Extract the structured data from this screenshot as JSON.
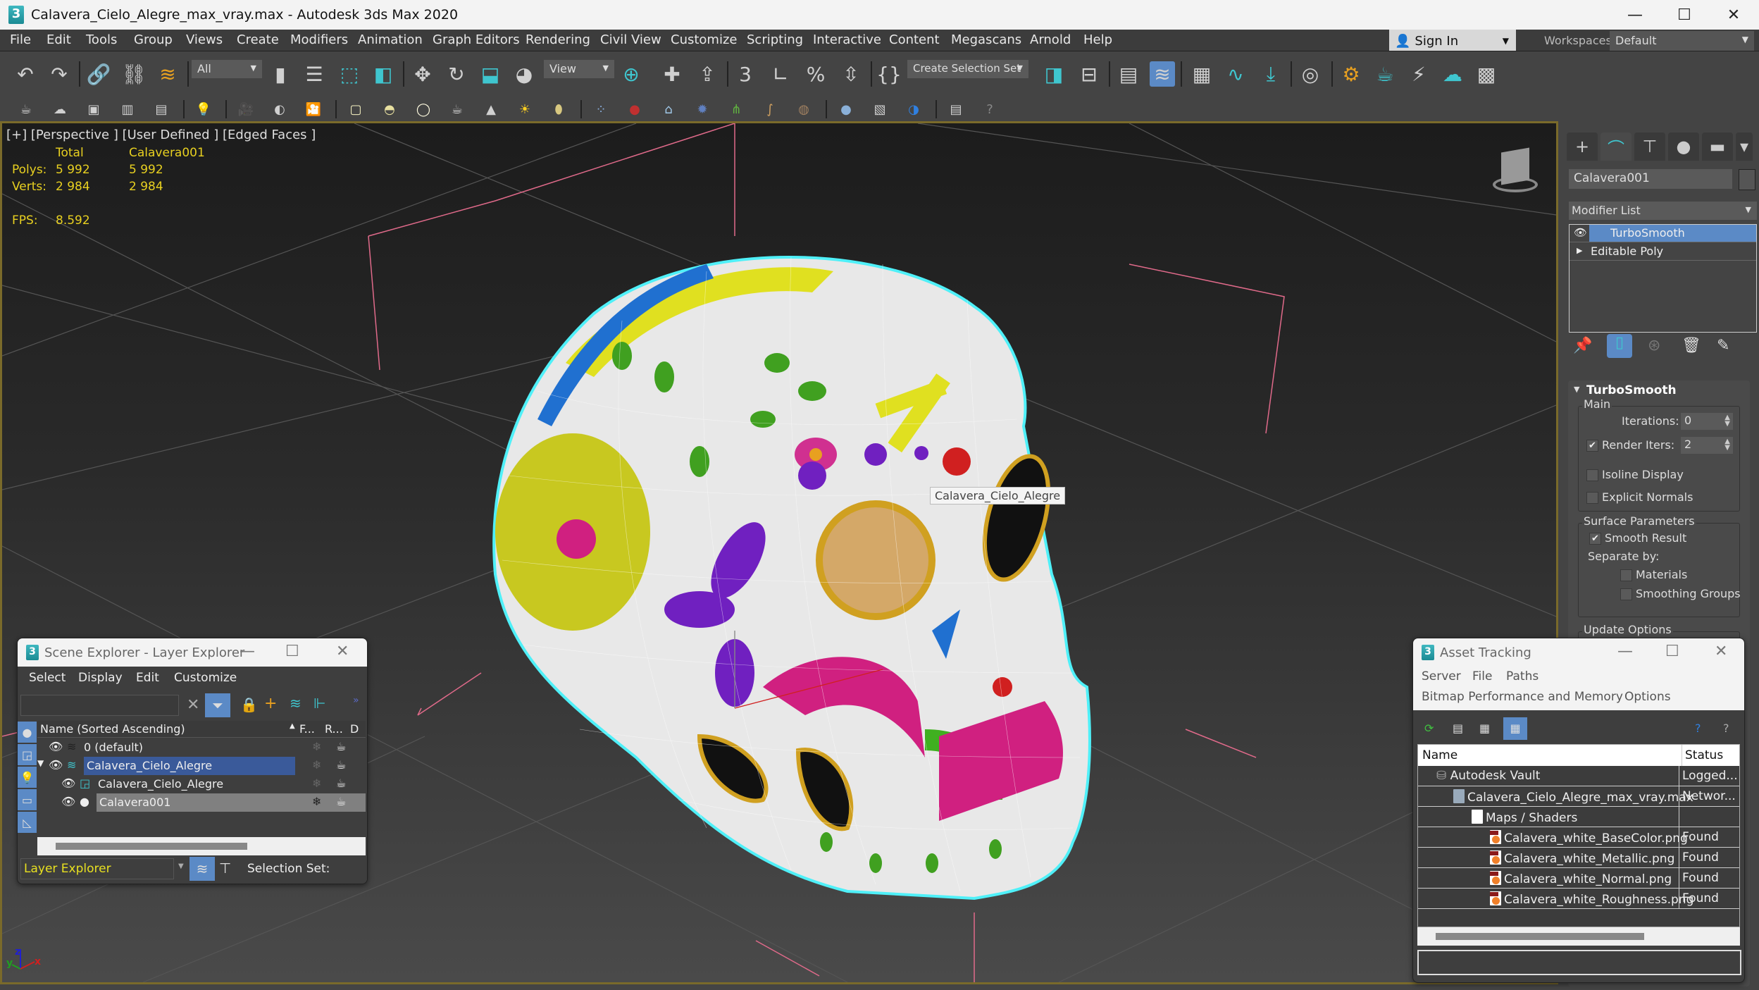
{
  "window": {
    "title": "Calavera_Cielo_Alegre_max_vray.max - Autodesk 3ds Max 2020",
    "app_icon_label": "3",
    "minimize": "—",
    "maximize": "☐",
    "close": "✕"
  },
  "menu": {
    "items": [
      "File",
      "Edit",
      "Tools",
      "Group",
      "Views",
      "Create",
      "Modifiers",
      "Animation",
      "Graph Editors",
      "Rendering",
      "Civil View",
      "Customize",
      "Scripting",
      "Interactive",
      "Content",
      "Megascans",
      "Arnold",
      "Help"
    ]
  },
  "account": {
    "sign_in_label": "Sign In",
    "workspaces_label": "Workspaces:",
    "workspace_value": "Default"
  },
  "toolbar": {
    "selection_filter": "All",
    "reference_coord": "View",
    "selection_set_placeholder": "Create Selection Set"
  },
  "viewport": {
    "label": "[+] [Perspective ] [User Defined ] [Edged Faces ]",
    "stats": {
      "col_total": "Total",
      "col_object": "Calavera001",
      "polys_label": "Polys:",
      "polys_total": "5 992",
      "polys_object": "5 992",
      "verts_label": "Verts:",
      "verts_total": "2 984",
      "verts_object": "2 984",
      "fps_label": "FPS:",
      "fps_value": "8.592"
    },
    "tooltip": "Calavera_Cielo_Alegre",
    "axis": {
      "x": "x",
      "y": "y",
      "z": "z"
    }
  },
  "command_panel": {
    "object_name": "Calavera001",
    "modifier_list_label": "Modifier List",
    "stack": [
      {
        "label": "TurboSmooth",
        "selected": true
      },
      {
        "label": "Editable Poly",
        "selected": false
      }
    ],
    "rollout": {
      "title": "TurboSmooth",
      "main_group": "Main",
      "iterations_label": "Iterations:",
      "iterations_value": "0",
      "render_iters_label": "Render Iters:",
      "render_iters_value": "2",
      "render_iters_checked": true,
      "isoline_label": "Isoline Display",
      "isoline_checked": false,
      "explicit_normals_label": "Explicit Normals",
      "explicit_normals_checked": false,
      "surface_group": "Surface Parameters",
      "smooth_result_label": "Smooth Result",
      "smooth_result_checked": true,
      "separate_by_label": "Separate by:",
      "materials_label": "Materials",
      "smoothing_groups_label": "Smoothing Groups",
      "update_group": "Update Options"
    }
  },
  "scene_explorer": {
    "title": "Scene Explorer - Layer Explorer",
    "menu": [
      "Select",
      "Display",
      "Edit",
      "Customize"
    ],
    "search_value": "",
    "columns": {
      "name": "Name (Sorted Ascending)",
      "freeze": "F...",
      "render": "R...",
      "display": "D"
    },
    "rows": [
      {
        "name": "0 (default)",
        "type": "layer",
        "indent": 0,
        "highlight": "none"
      },
      {
        "name": "Calavera_Cielo_Alegre",
        "type": "layer-active",
        "indent": 0,
        "highlight": "active-layer",
        "expanded": true
      },
      {
        "name": "Calavera_Cielo_Alegre",
        "type": "group",
        "indent": 1,
        "highlight": "none"
      },
      {
        "name": "Calavera001",
        "type": "object",
        "indent": 1,
        "highlight": "selected"
      }
    ],
    "footer_mode": "Layer Explorer",
    "selection_set_label": "Selection Set:"
  },
  "asset_tracking": {
    "title": "Asset Tracking",
    "menu_row1": [
      "Server",
      "File",
      "Paths"
    ],
    "menu_row2": [
      "Bitmap Performance and Memory",
      "Options"
    ],
    "columns": {
      "name": "Name",
      "status": "Status"
    },
    "rows": [
      {
        "name": "Autodesk Vault",
        "status": "Logged...",
        "indent": 1,
        "icon": "vault"
      },
      {
        "name": "Calavera_Cielo_Alegre_max_vray.max",
        "status": "Networ...",
        "indent": 2,
        "icon": "max"
      },
      {
        "name": "Maps / Shaders",
        "status": "",
        "indent": 3,
        "icon": "maps"
      },
      {
        "name": "Calavera_white_BaseColor.png",
        "status": "Found",
        "indent": 4,
        "icon": "png"
      },
      {
        "name": "Calavera_white_Metallic.png",
        "status": "Found",
        "indent": 4,
        "icon": "png"
      },
      {
        "name": "Calavera_white_Normal.png",
        "status": "Found",
        "indent": 4,
        "icon": "png"
      },
      {
        "name": "Calavera_white_Roughness.png",
        "status": "Found",
        "indent": 4,
        "icon": "png"
      }
    ]
  },
  "colors": {
    "accent_blue": "#5b8ac6",
    "teal": "#3fc6cf",
    "stats_yellow": "#e8d020",
    "viewport_border": "#7a6a2a",
    "selection_cyan": "#4ff0f8"
  }
}
